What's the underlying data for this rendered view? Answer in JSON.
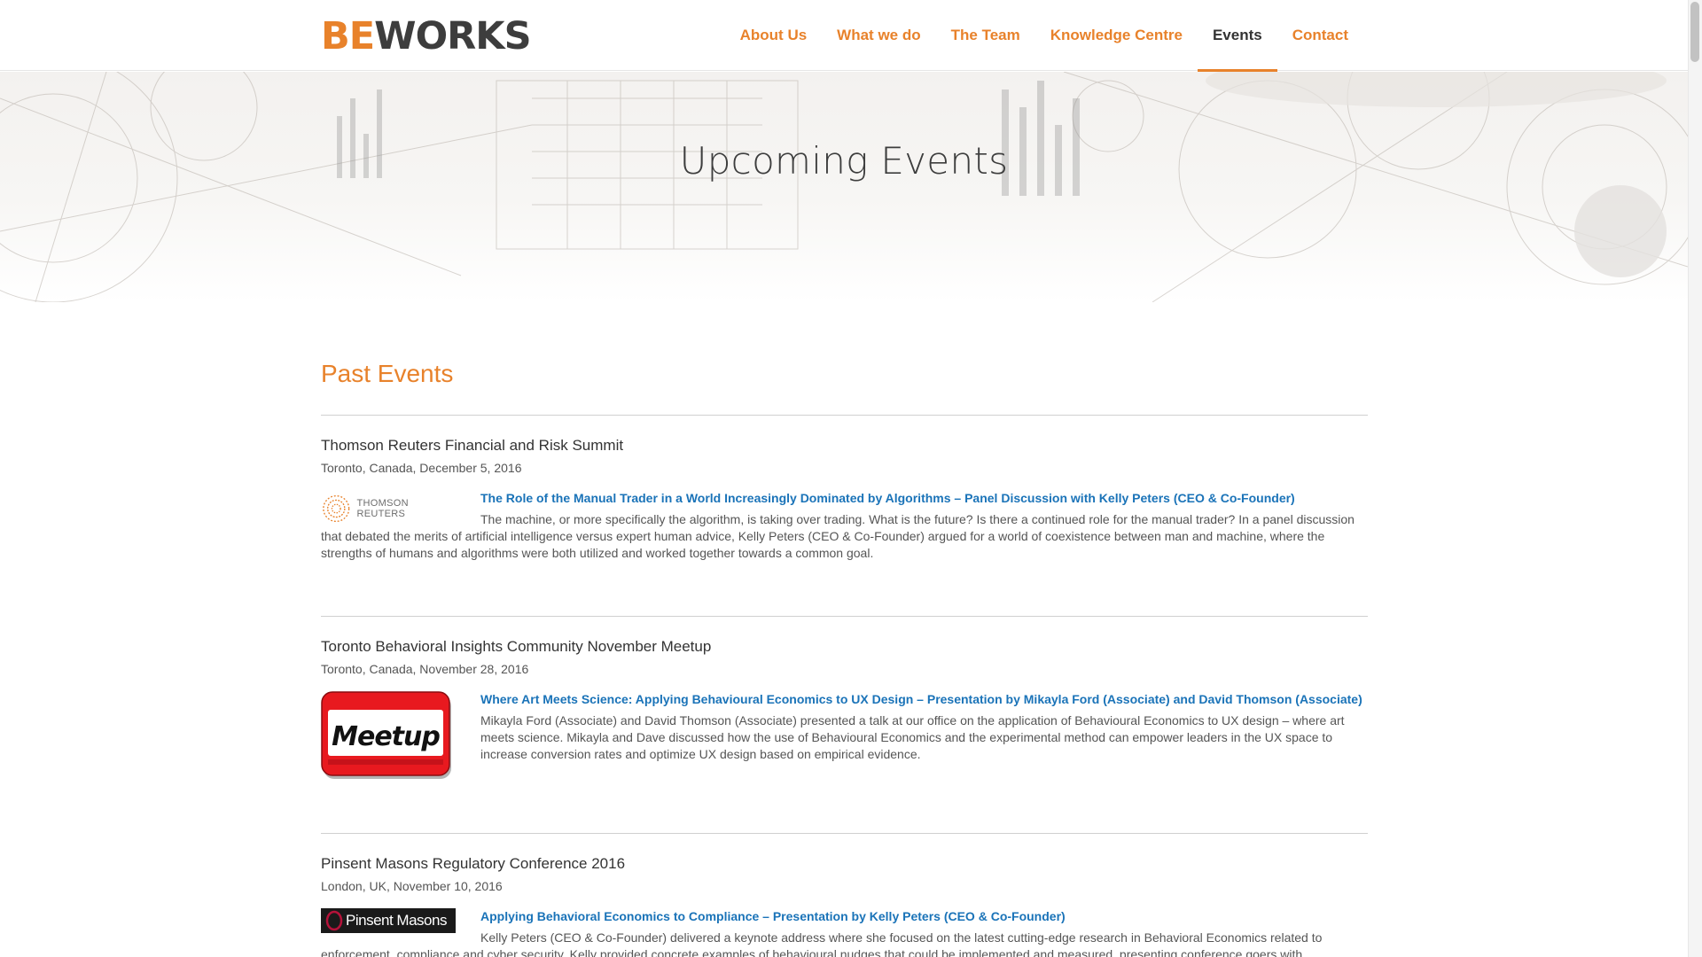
{
  "brand": {
    "be": "BE",
    "works": "WORKS"
  },
  "nav": [
    {
      "label": "About Us",
      "active": false
    },
    {
      "label": "What we do",
      "active": false
    },
    {
      "label": "The Team",
      "active": false
    },
    {
      "label": "Knowledge Centre",
      "active": false
    },
    {
      "label": "Events",
      "active": true
    },
    {
      "label": "Contact",
      "active": false
    }
  ],
  "hero": {
    "title": "Upcoming Events"
  },
  "past_events": {
    "title": "Past Events",
    "items": [
      {
        "title": "Thomson Reuters Financial and Risk Summit",
        "meta": "Toronto, Canada, December 5, 2016",
        "logo": "THOMSON REUTERS",
        "link": "The Role of the Manual Trader in a World Increasingly Dominated by Algorithms – Panel Discussion with Kelly Peters (CEO & Co-Founder)",
        "desc": "The machine, or more specifically the algorithm, is taking over trading.  What is the future? Is there a continued role for the manual trader? In a panel discussion that debated the merits of artificial intelligence versus expert human advice, Kelly Peters (CEO & Co-Founder) argued for a world of coexistence between man and machine, where the strengths of humans and algorithms were both utilized and worked together towards a common goal."
      },
      {
        "title": "Toronto Behavioral Insights Community November Meetup",
        "meta": "Toronto, Canada, November 28, 2016",
        "logo": "Meetup",
        "link": "Where Art Meets Science: Applying Behavioural Economics to UX Design – Presentation by Mikayla Ford (Associate) and David Thomson (Associate)",
        "desc": "Mikayla Ford (Associate) and David Thomson (Associate) presented a talk at our office on the application of Behavioural Economics to UX design – where art meets science. Mikayla and Dave discussed how the use of Behavioural Economics and the experimental method can empower leaders in the UX space to increase conversion rates and optimize UX design based on empirical evidence."
      },
      {
        "title": "Pinsent Masons Regulatory Conference 2016",
        "meta": "London, UK, November 10, 2016",
        "logo": "Pinsent Masons",
        "link": "Applying Behavioral Economics to Compliance – Presentation by Kelly Peters (CEO & Co-Founder)",
        "desc": "Kelly Peters (CEO & Co-Founder) delivered a keynote address where she focused on the latest cutting-edge research in Behavioral Economics related to enforcement, compliance and cyber security. Kelly provided concrete examples of behavioural nudges that could be implemented and measured, presenting conference goers with"
      }
    ]
  },
  "colors": {
    "accent": "#e8822b",
    "link": "#1a73b8",
    "text": "#444444",
    "meetup_red": "#e8191f"
  }
}
